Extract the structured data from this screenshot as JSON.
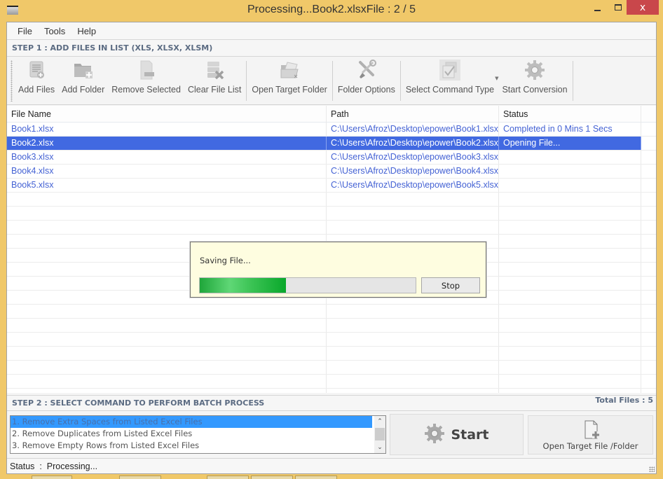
{
  "window": {
    "title": "Processing...Book2.xlsxFile : 2 / 5",
    "icons": {
      "app": "app-icon",
      "minimize": "minimize-icon",
      "maximize": "maximize-icon",
      "close": "close-icon"
    },
    "close_glyph": "x"
  },
  "menu": {
    "items": [
      {
        "label": "File"
      },
      {
        "label": "Tools"
      },
      {
        "label": "Help"
      }
    ]
  },
  "step1": {
    "title": "STEP 1 : ADD FILES IN LIST (XLS, XLSX, XLSM)"
  },
  "toolbar": {
    "buttons": [
      {
        "label": "Add Files",
        "icon": "add-files-icon"
      },
      {
        "label": "Add Folder",
        "icon": "add-folder-icon"
      },
      {
        "label": "Remove Selected",
        "icon": "remove-selected-icon"
      },
      {
        "label": "Clear File List",
        "icon": "clear-list-icon"
      },
      {
        "label": "Open Target Folder",
        "icon": "open-folder-icon"
      },
      {
        "label": "Folder Options",
        "icon": "tools-icon"
      },
      {
        "label": "Select Command Type",
        "icon": "checkbox-doc-icon"
      },
      {
        "label": "Start Conversion",
        "icon": "gear-icon"
      }
    ]
  },
  "grid": {
    "columns": [
      "File Name",
      "Path",
      "Status"
    ],
    "rows": [
      {
        "name": "Book1.xlsx",
        "path": "C:\\Users\\Afroz\\Desktop\\epower\\Book1.xlsx",
        "status": "Completed in 0 Mins 1 Secs",
        "selected": false
      },
      {
        "name": "Book2.xlsx",
        "path": "C:\\Users\\Afroz\\Desktop\\epower\\Book2.xlsx",
        "status": "Opening File...",
        "selected": true
      },
      {
        "name": "Book3.xlsx",
        "path": "C:\\Users\\Afroz\\Desktop\\epower\\Book3.xlsx",
        "status": "",
        "selected": false
      },
      {
        "name": "Book4.xlsx",
        "path": "C:\\Users\\Afroz\\Desktop\\epower\\Book4.xlsx",
        "status": "",
        "selected": false
      },
      {
        "name": "Book5.xlsx",
        "path": "C:\\Users\\Afroz\\Desktop\\epower\\Book5.xlsx",
        "status": "",
        "selected": false
      }
    ],
    "colors": {
      "link": "#4462d4",
      "selected_bg": "#4169e1"
    }
  },
  "progress_dialog": {
    "message": "Saving File...",
    "progress_percent": 40,
    "stop_label": "Stop"
  },
  "step2": {
    "title": "STEP 2 : SELECT COMMAND TO PERFORM BATCH PROCESS",
    "total_files": "Total Files : 5",
    "commands": [
      {
        "label": "1. Remove Extra Spaces from Listed Excel Files",
        "selected": true
      },
      {
        "label": "2. Remove Duplicates from Listed Excel Files",
        "selected": false
      },
      {
        "label": "3. Remove Empty Rows from Listed Excel Files",
        "selected": false
      }
    ],
    "start_label": "Start",
    "open_target_label": "Open Target File /Folder"
  },
  "status": {
    "text": "Status  :  Processing..."
  }
}
